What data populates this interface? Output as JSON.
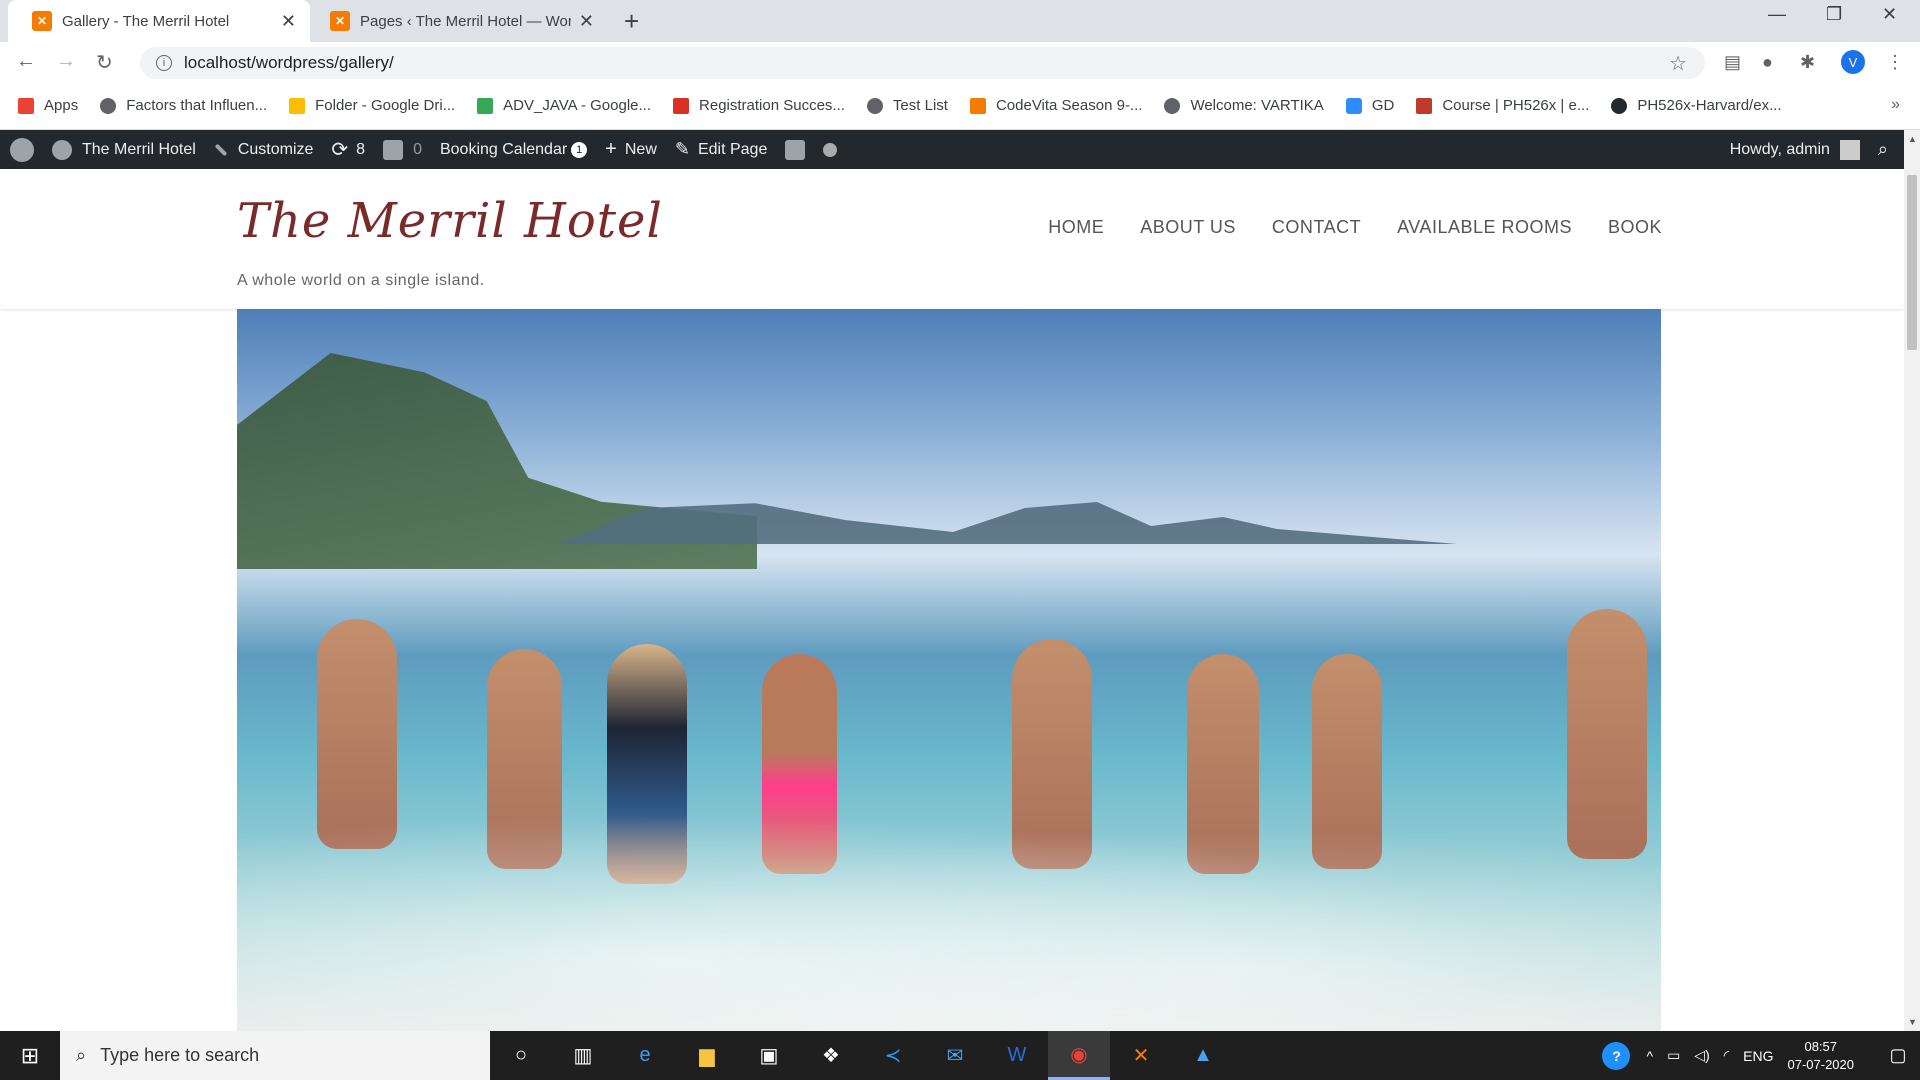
{
  "browser": {
    "tabs": [
      {
        "title": "Gallery - The Merril Hotel",
        "active": true
      },
      {
        "title": "Pages ‹ The Merril Hotel — Word",
        "active": false
      }
    ],
    "new_tab": "+",
    "address": "localhost/wordpress/gallery/",
    "profile_initial": "V",
    "bookmarks": [
      "Apps",
      "Factors that Influen...",
      "Folder - Google Dri...",
      "ADV_JAVA - Google...",
      "Registration Succes...",
      "Test List",
      "CodeVita Season 9-...",
      "Welcome: VARTIKA",
      "GD",
      "Course | PH526x | e...",
      "PH526x-Harvard/ex..."
    ],
    "bookmarks_more": "»"
  },
  "adminbar": {
    "site_name": "The Merril Hotel",
    "customize": "Customize",
    "updates_count": "8",
    "comments_count": "0",
    "booking_calendar": "Booking Calendar",
    "booking_badge": "1",
    "new": "New",
    "edit_page": "Edit Page",
    "howdy": "Howdy, admin"
  },
  "site": {
    "title": "The Merril Hotel",
    "tagline": "A whole world on a single island.",
    "nav": [
      "HOME",
      "ABOUT US",
      "CONTACT",
      "AVAILABLE ROOMS",
      "BOOK"
    ]
  },
  "taskbar": {
    "search_placeholder": "Type here to search",
    "language": "ENG",
    "time": "08:57",
    "date": "07-07-2020"
  }
}
